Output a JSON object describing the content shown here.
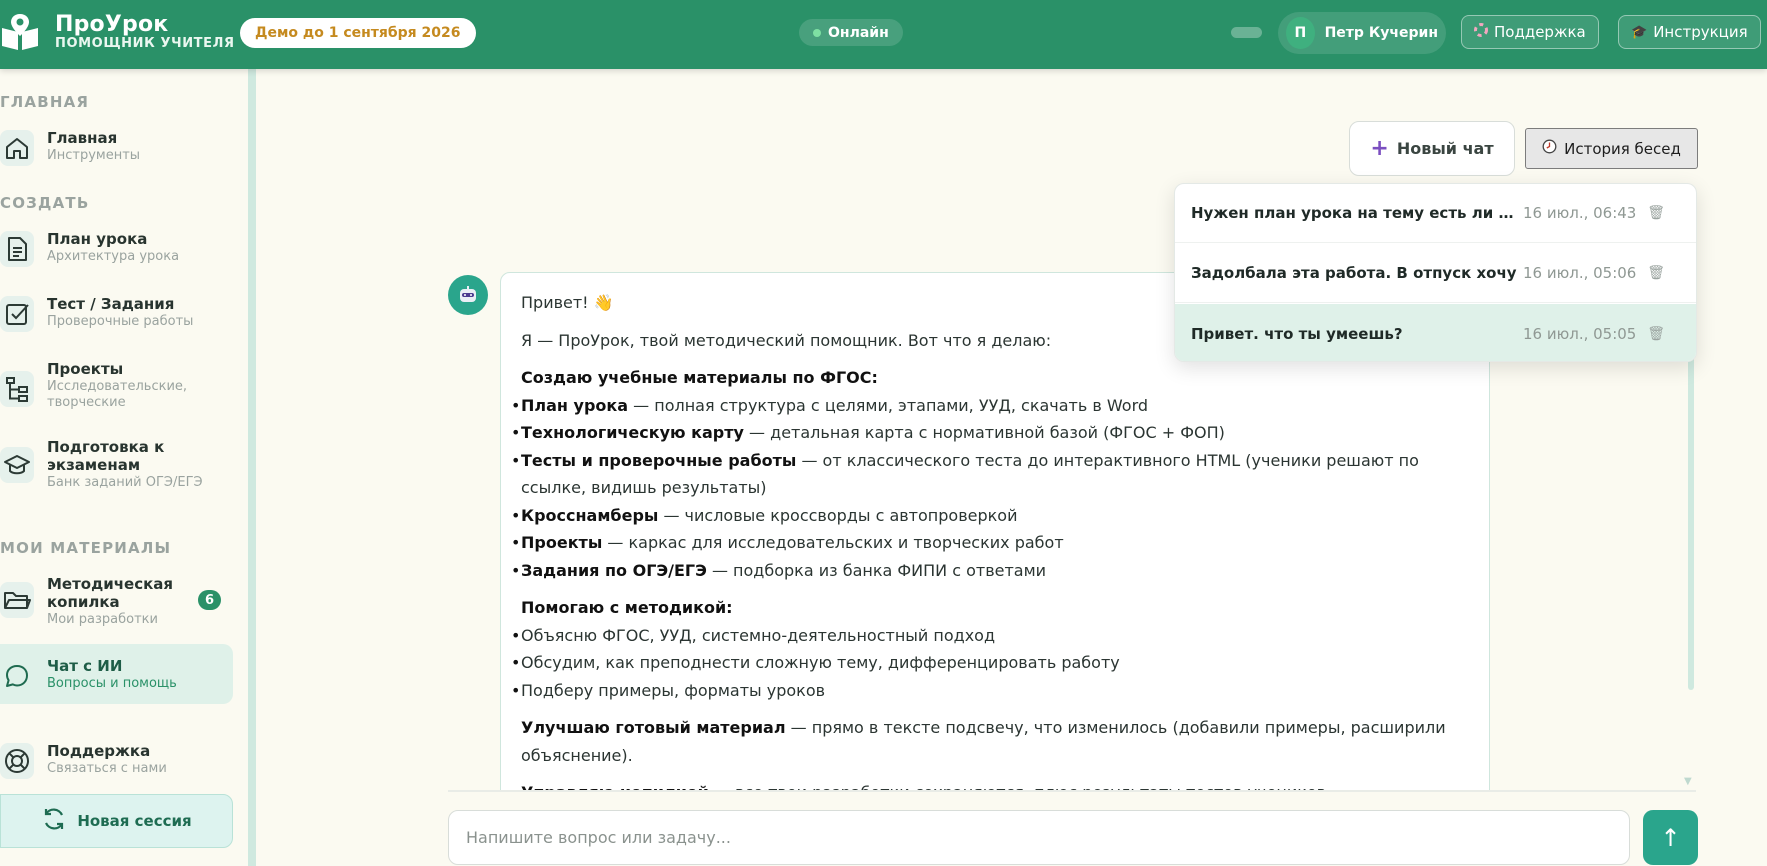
{
  "header": {
    "brand_title": "ПроУрок",
    "brand_subtitle": "ПОМОЩНИК УЧИТЕЛЯ",
    "demo_label": "Демо до 1 сентября 2026",
    "online_label": "Онлайн",
    "user": {
      "initial": "П",
      "name": "Петр Кучерин"
    },
    "support_label": "Поддержка",
    "support_icon": "support-icon",
    "instruction_label": "Инструкция",
    "instruction_icon": "graduation-cap-icon"
  },
  "sidebar": {
    "sections": {
      "main": "ГЛАВНАЯ",
      "create": "СОЗДАТЬ",
      "materials": "МОИ МАТЕРИАЛЫ"
    },
    "items": [
      {
        "title": "Главная",
        "subtitle": "Инструменты",
        "icon": "home-icon"
      },
      {
        "title": "План урока",
        "subtitle": "Архитектура урока",
        "icon": "document-icon"
      },
      {
        "title": "Тест / Задания",
        "subtitle": "Проверочные работы",
        "icon": "checkbox-icon"
      },
      {
        "title": "Проекты",
        "subtitle": "Исследовательские, творческие",
        "icon": "tree-icon"
      },
      {
        "title": "Подготовка к экзаменам",
        "subtitle": "Банк заданий ОГЭ/ЕГЭ",
        "icon": "graduation-cap-icon"
      },
      {
        "title": "Методическая копилка",
        "subtitle": "Мои разработки",
        "icon": "folder-icon",
        "badge": "6"
      },
      {
        "title": "Чат с ИИ",
        "subtitle": "Вопросы и помощь",
        "icon": "chat-icon",
        "active": true
      },
      {
        "title": "Поддержка",
        "subtitle": "Связаться с нами",
        "icon": "lifebuoy-icon"
      }
    ],
    "new_session_label": "Новая сессия"
  },
  "chat": {
    "new_chat_label": "Новый чат",
    "history_label": "История бесед",
    "history": [
      {
        "title": "Нужен план урока на тему есть ли ж...",
        "time": "16 июл., 06:43"
      },
      {
        "title": "Задолбала эта работа. В отпуск хочу",
        "time": "16 июл., 05:06"
      },
      {
        "title": "Привет. что ты умеешь?",
        "time": "16 июл., 05:05",
        "active": true
      }
    ],
    "message": {
      "greeting": "Привет! 👋",
      "intro": "Я — ПроУрок, твой методический помощник. Вот что я делаю:",
      "section1_title": "Создаю учебные материалы по ФГОС:",
      "section1_items": [
        {
          "bold": "План урока",
          "text": " — полная структура с целями, этапами, УУД, скачать в Word"
        },
        {
          "bold": "Технологическую карту",
          "text": " — детальная карта с нормативной базой (ФГОС + ФОП)"
        },
        {
          "bold": "Тесты и проверочные работы",
          "text": " — от классического теста до интерактивного HTML (ученики решают по ссылке, видишь результаты)"
        },
        {
          "bold": "Кросснамберы",
          "text": " — числовые кроссворды с автопроверкой"
        },
        {
          "bold": "Проекты",
          "text": " — каркас для исследовательских и творческих работ"
        },
        {
          "bold": "Задания по ОГЭ/ЕГЭ",
          "text": " — подборка из банка ФИПИ с ответами"
        }
      ],
      "section2_title": "Помогаю с методикой:",
      "section2_items": [
        "Объясню ФГОС, УУД, системно-деятельностный подход",
        "Обсудим, как преподнести сложную тему, дифференцировать работу",
        "Подберу примеры, форматы уроков"
      ],
      "section3_bold": "Улучшаю готовый материал",
      "section3_text": " — прямо в тексте подсвечу, что изменилось (добавили примеры, расширили объяснение).",
      "section4_bold": "Управляю копилкой",
      "section4_text": " — все твои разработки сохраняются, плюс результаты тестов учеников"
    },
    "input_placeholder": "Напишите вопрос или задачу...",
    "send_icon": "arrow-up-icon"
  }
}
